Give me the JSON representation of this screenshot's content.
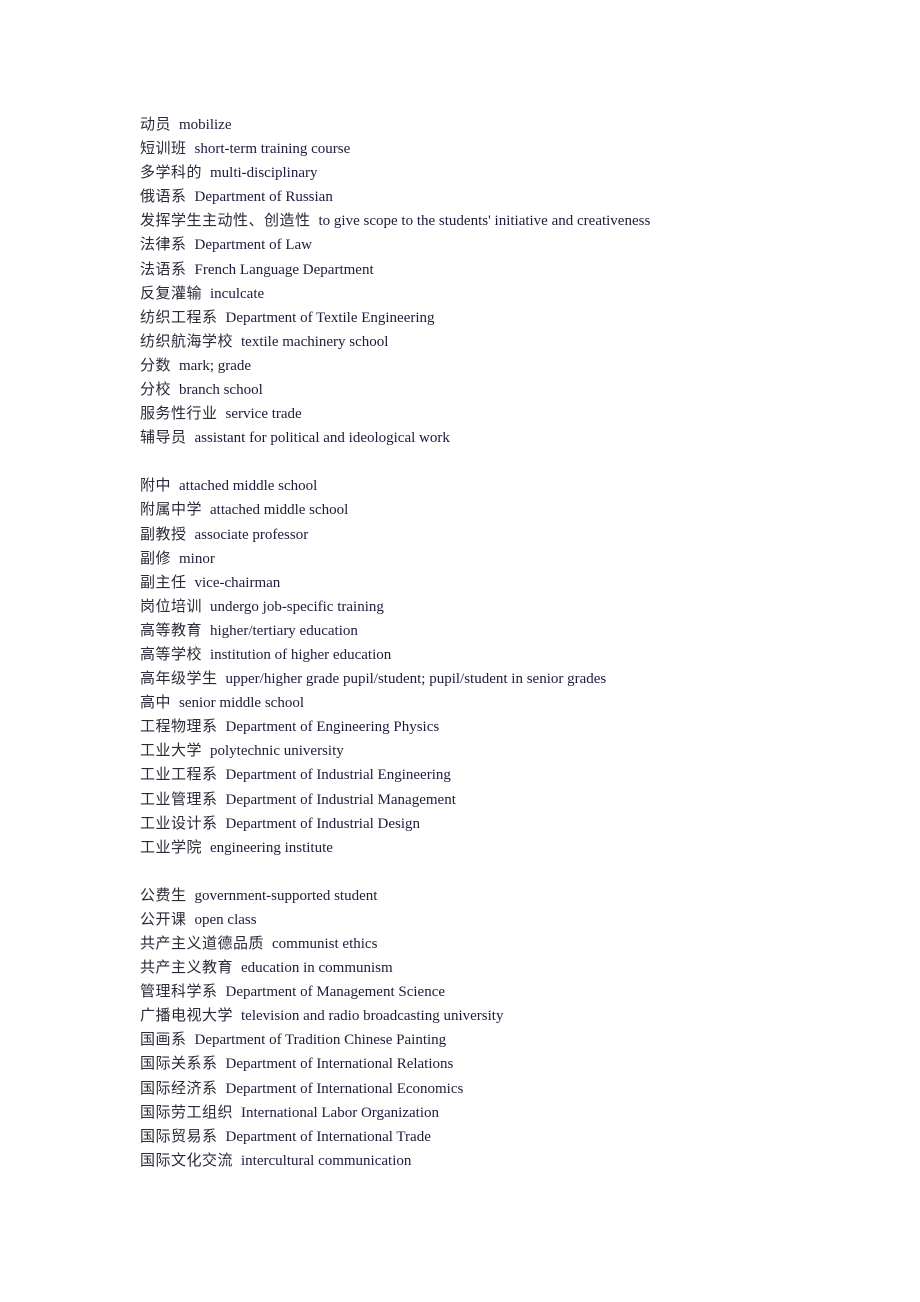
{
  "groups": [
    {
      "entries": [
        {
          "zh": "动员",
          "en": "mobilize"
        },
        {
          "zh": "短训班",
          "en": "short-term training course"
        },
        {
          "zh": "多学科的",
          "en": "multi-disciplinary"
        },
        {
          "zh": "俄语系",
          "en": "Department of Russian"
        },
        {
          "zh": "发挥学生主动性、创造性",
          "en": "to give scope to the students' initiative and creativeness"
        },
        {
          "zh": "法律系",
          "en": "Department of Law"
        },
        {
          "zh": "法语系",
          "en": "French Language Department"
        },
        {
          "zh": "反复灌输",
          "en": "inculcate"
        },
        {
          "zh": "纺织工程系",
          "en": "Department of Textile Engineering"
        },
        {
          "zh": "纺织航海学校",
          "en": "textile machinery school"
        },
        {
          "zh": "分数",
          "en": "mark; grade"
        },
        {
          "zh": "分校",
          "en": "branch school"
        },
        {
          "zh": "服务性行业",
          "en": "service trade"
        },
        {
          "zh": "辅导员",
          "en": "assistant for political and ideological work"
        }
      ]
    },
    {
      "entries": [
        {
          "zh": "附中",
          "en": "attached middle school"
        },
        {
          "zh": "附属中学",
          "en": "attached middle school"
        },
        {
          "zh": "副教授",
          "en": "associate professor"
        },
        {
          "zh": "副修",
          "en": "minor"
        },
        {
          "zh": "副主任",
          "en": "vice-chairman"
        },
        {
          "zh": "岗位培训",
          "en": "undergo job-specific training"
        },
        {
          "zh": "高等教育",
          "en": "higher/tertiary education"
        },
        {
          "zh": "高等学校",
          "en": "institution of higher education"
        },
        {
          "zh": "高年级学生",
          "en": "upper/higher grade pupil/student; pupil/student in senior grades"
        },
        {
          "zh": "高中",
          "en": "senior middle school"
        },
        {
          "zh": "工程物理系",
          "en": "Department of Engineering Physics"
        },
        {
          "zh": "工业大学",
          "en": "polytechnic university"
        },
        {
          "zh": "工业工程系",
          "en": "Department of Industrial Engineering"
        },
        {
          "zh": "工业管理系",
          "en": "Department of Industrial Management"
        },
        {
          "zh": "工业设计系",
          "en": "Department of Industrial Design"
        },
        {
          "zh": "工业学院",
          "en": "engineering institute"
        }
      ]
    },
    {
      "entries": [
        {
          "zh": "公费生",
          "en": "government-supported student"
        },
        {
          "zh": "公开课",
          "en": "open class"
        },
        {
          "zh": "共产主义道德品质",
          "en": "communist ethics"
        },
        {
          "zh": "共产主义教育",
          "en": "education in communism"
        },
        {
          "zh": "管理科学系",
          "en": "Department of Management Science"
        },
        {
          "zh": "广播电视大学",
          "en": "television and radio broadcasting university"
        },
        {
          "zh": "国画系",
          "en": "Department of Tradition Chinese Painting"
        },
        {
          "zh": "国际关系系",
          "en": "Department of International Relations"
        },
        {
          "zh": "国际经济系",
          "en": "Department of International Economics"
        },
        {
          "zh": "国际劳工组织",
          "en": "International Labor Organization"
        },
        {
          "zh": "国际贸易系",
          "en": "Department of International Trade"
        },
        {
          "zh": "国际文化交流",
          "en": "intercultural communication"
        }
      ]
    }
  ]
}
